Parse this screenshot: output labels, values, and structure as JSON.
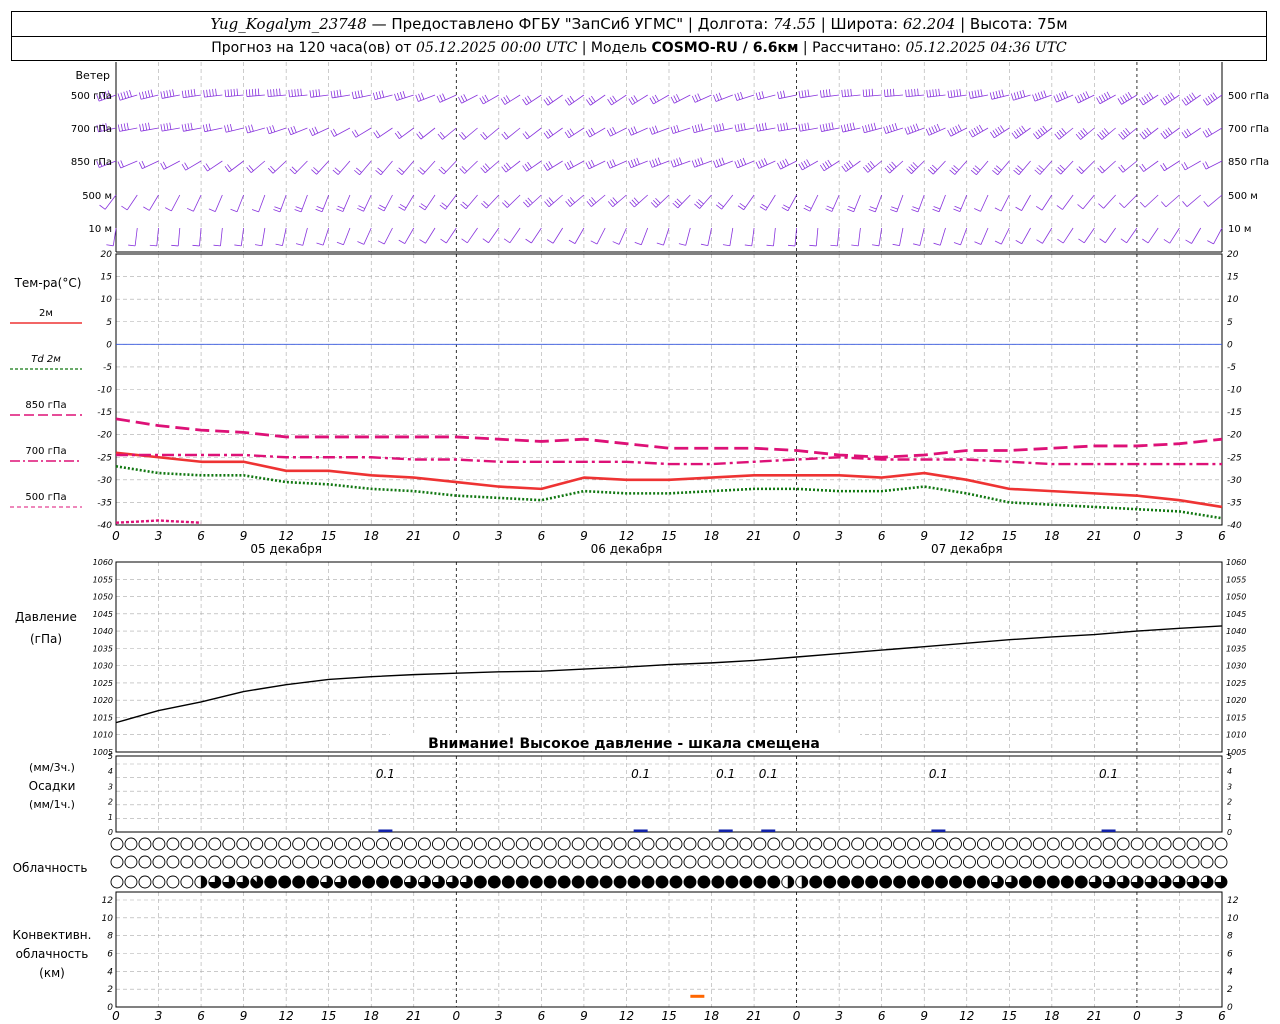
{
  "header": {
    "station": "Yug_Kogalym_23748",
    "provider": " — Предоставлено ФГБУ \"ЗапСиб УГМС\" | Долгота: ",
    "lon": "74.55",
    "lat_label": " | Широта: ",
    "lat": "62.204",
    "alt_label": " | Высота: ",
    "alt": "75м",
    "forecast_label": "Прогноз на 120 часа(ов) от ",
    "forecast_start": "05.12.2025 00:00 UTC",
    "model_label": "  | Модель ",
    "model": "COSMO-RU / 6.6км",
    "calc_label": " | Рассчитано: ",
    "calc_time": "05.12.2025 04:36 UTC"
  },
  "colors": {
    "t2m": "#ee3333",
    "td2m": "#117711",
    "t850": "#dd1177",
    "t700": "#dd1177",
    "t500": "#dd1177",
    "wind": "#8833dd",
    "zero_line": "#3355dd",
    "conv": "#ff6600",
    "precip": "#1122aa"
  },
  "wind_panel": {
    "title": "Ветер",
    "levels": [
      "500 гПа",
      "700 гПа",
      "850 гПа",
      "500 м",
      "10  м"
    ]
  },
  "temp_panel": {
    "title": "Тем-ра(°C)",
    "legend": [
      {
        "key": "t2m",
        "label": "2м"
      },
      {
        "key": "td2m",
        "label": "2м",
        "prefix": "Td"
      },
      {
        "key": "t850",
        "label": "850 гПа"
      },
      {
        "key": "t700",
        "label": "700 гПа"
      },
      {
        "key": "t500",
        "label": "500 гПа"
      }
    ],
    "ticks": [
      20,
      15,
      10,
      5,
      0,
      -5,
      -10,
      -15,
      -20,
      -25,
      -30,
      -35,
      -40
    ]
  },
  "x_axis": {
    "hour_labels": [
      "0",
      "3",
      "6",
      "9",
      "12",
      "15",
      "18",
      "21",
      "0",
      "3",
      "6",
      "9",
      "12",
      "15",
      "18",
      "21",
      "0",
      "3",
      "6",
      "9",
      "12",
      "15",
      "18",
      "21",
      "0",
      "3",
      "6"
    ],
    "day_labels": [
      "05 декабря",
      "06 декабря",
      "07 декабря"
    ]
  },
  "pressure_panel": {
    "title": "Давление",
    "unit": "(гПа)",
    "warning": "Внимание! Высокое давление - шкала смещена",
    "ticks": [
      1060,
      1055,
      1050,
      1045,
      1040,
      1035,
      1030,
      1025,
      1020,
      1015,
      1010,
      1005
    ]
  },
  "precip_panel": {
    "unit3h": "(мм/3ч.)",
    "title": "Осадки",
    "unit1h": "(мм/1ч.)",
    "ticks": [
      5,
      4,
      3,
      2,
      1,
      0
    ],
    "labels": [
      {
        "hour": 19,
        "value": "0.1"
      },
      {
        "hour": 37,
        "value": "0.1"
      },
      {
        "hour": 43,
        "value": "0.1"
      },
      {
        "hour": 46,
        "value": "0.1"
      },
      {
        "hour": 58,
        "value": "0.1"
      },
      {
        "hour": 70,
        "value": "0.1"
      }
    ]
  },
  "cloud_panel": {
    "title": "Облачность"
  },
  "conv_panel": {
    "title1": "Конвективн.",
    "title2": "облачность",
    "unit": "(км)",
    "ticks": [
      12,
      10,
      8,
      6,
      4,
      2,
      0
    ]
  },
  "chart_data": [
    {
      "type": "line",
      "title": "Тем-ра(°C)",
      "ylim": [
        -40,
        20
      ],
      "x_unit": "hours from 05.12.2025 00:00 UTC",
      "x": [
        0,
        3,
        6,
        9,
        12,
        15,
        18,
        21,
        24,
        27,
        30,
        33,
        36,
        39,
        42,
        45,
        48,
        51,
        54,
        57,
        60,
        63,
        66,
        69,
        72,
        75,
        78
      ],
      "series": [
        {
          "name": "2м",
          "key": "t2m",
          "values": [
            -24,
            -25,
            -26,
            -26,
            -28,
            -28,
            -29,
            -29.5,
            -30.5,
            -31.5,
            -32,
            -29.5,
            -30,
            -30,
            -29.5,
            -29,
            -29,
            -29,
            -29.5,
            -28.5,
            -30,
            -32,
            -32.5,
            -33,
            -33.5,
            -34.5,
            -36
          ]
        },
        {
          "name": "Td 2м",
          "key": "td2m",
          "values": [
            -27,
            -28.5,
            -29,
            -29,
            -30.5,
            -31,
            -32,
            -32.5,
            -33.5,
            -34,
            -34.5,
            -32.5,
            -33,
            -33,
            -32.5,
            -32,
            -32,
            -32.5,
            -32.5,
            -31.5,
            -33,
            -35,
            -35.5,
            -36,
            -36.5,
            -37,
            -38.5
          ]
        },
        {
          "name": "850 гПа",
          "key": "t850",
          "values": [
            -16.5,
            -18,
            -19,
            -19.5,
            -20.5,
            -20.5,
            -20.5,
            -20.5,
            -20.5,
            -21,
            -21.5,
            -21,
            -22,
            -23,
            -23,
            -23,
            -23.5,
            -24.5,
            -25,
            -24.5,
            -23.5,
            -23.5,
            -23,
            -22.5,
            -22.5,
            -22,
            -21
          ]
        },
        {
          "name": "700 гПа",
          "key": "t700",
          "values": [
            -24.5,
            -24.5,
            -24.5,
            -24.5,
            -25,
            -25,
            -25,
            -25.5,
            -25.5,
            -26,
            -26,
            -26,
            -26,
            -26.5,
            -26.5,
            -26,
            -25.5,
            -25,
            -25.5,
            -25.5,
            -25.5,
            -26,
            -26.5,
            -26.5,
            -26.5,
            -26.5,
            -26.5
          ]
        },
        {
          "name": "500 гПа",
          "key": "t500",
          "values": [
            -39.5,
            -39,
            -39.5
          ]
        }
      ]
    },
    {
      "type": "line",
      "title": "Давление",
      "ylim": [
        1005,
        1060
      ],
      "x_unit": "hours from 05.12.2025 00:00 UTC",
      "x": [
        0,
        3,
        6,
        9,
        12,
        15,
        18,
        21,
        24,
        27,
        30,
        33,
        36,
        39,
        42,
        45,
        48,
        51,
        54,
        57,
        60,
        63,
        66,
        69,
        72,
        75,
        78
      ],
      "series": [
        {
          "name": "Давление",
          "values": [
            1013.5,
            1017,
            1019.5,
            1022.5,
            1024.5,
            1026,
            1026.8,
            1027.4,
            1027.8,
            1028.2,
            1028.4,
            1029,
            1029.6,
            1030.3,
            1030.8,
            1031.5,
            1032.5,
            1033.5,
            1034.5,
            1035.5,
            1036.5,
            1037.5,
            1038.3,
            1039,
            1040,
            1040.8,
            1041.5
          ]
        }
      ]
    },
    {
      "type": "bar",
      "title": "Осадки",
      "ylim": [
        0,
        5
      ],
      "x_unit": "hours from 05.12.2025 00:00 UTC",
      "x": [
        19,
        37,
        43,
        46,
        58,
        70
      ],
      "series": [
        {
          "name": "Осадки",
          "values": [
            0.1,
            0.1,
            0.1,
            0.1,
            0.1,
            0.1
          ]
        }
      ]
    },
    {
      "type": "bar",
      "title": "Конвективн. облачность",
      "ylim": [
        0,
        12
      ],
      "x_unit": "hours from 05.12.2025 00:00 UTC",
      "x": [
        41
      ],
      "series": [
        {
          "name": "Конвективн. облачность",
          "values": [
            1.2
          ]
        }
      ]
    },
    {
      "type": "table",
      "title": "Облачность",
      "note": "cloud cover in eighths per 2-hour step; rows = upper, middle, lower",
      "rows": [
        [
          0,
          0,
          0,
          0,
          0,
          0,
          0,
          0,
          0,
          0,
          0,
          0,
          0,
          0,
          0,
          0,
          0,
          0,
          0,
          0,
          0,
          0,
          0,
          0,
          0,
          0,
          0,
          0,
          0,
          0,
          0,
          0,
          0,
          0,
          0,
          0,
          0,
          0,
          0,
          0,
          0,
          0,
          0,
          0,
          0,
          0,
          0,
          0,
          0,
          0,
          0,
          0,
          0,
          0,
          0,
          0,
          0,
          0,
          0,
          0,
          0,
          0,
          0,
          0,
          0,
          0,
          0,
          0,
          0,
          0,
          0,
          0,
          0,
          0,
          0,
          0,
          0,
          0,
          0,
          0
        ],
        [
          0,
          0,
          0,
          0,
          0,
          0,
          0,
          0,
          0,
          0,
          0,
          0,
          0,
          0,
          0,
          0,
          0,
          0,
          0,
          0,
          0,
          0,
          0,
          0,
          0,
          0,
          0,
          0,
          0,
          0,
          0,
          0,
          0,
          0,
          0,
          0,
          0,
          0,
          0,
          0,
          0,
          0,
          0,
          0,
          0,
          0,
          0,
          0,
          0,
          0,
          0,
          0,
          0,
          0,
          0,
          0,
          0,
          0,
          0,
          0,
          0,
          0,
          0,
          0,
          0,
          0,
          0,
          0,
          0,
          0,
          0,
          0,
          0,
          0,
          0,
          0,
          0,
          0,
          0,
          0
        ],
        [
          0,
          0,
          0,
          0,
          0,
          0,
          4,
          6,
          6,
          6,
          7,
          8,
          8,
          8,
          8,
          6,
          6,
          8,
          8,
          8,
          8,
          6,
          6,
          6,
          6,
          6,
          8,
          8,
          8,
          8,
          8,
          8,
          8,
          8,
          8,
          8,
          8,
          8,
          8,
          8,
          8,
          8,
          8,
          8,
          8,
          8,
          8,
          8,
          4,
          4,
          8,
          8,
          8,
          8,
          8,
          8,
          8,
          8,
          8,
          8,
          8,
          8,
          8,
          6,
          6,
          8,
          8,
          8,
          8,
          8,
          6,
          6,
          6,
          6,
          6,
          6,
          6,
          6,
          6,
          6
        ]
      ]
    },
    {
      "type": "table",
      "title": "Ветер",
      "note": "wind barbs (direction deg, speed m/s) at 500 гПа, 700 гПа, 850 гПа, 500 м, 10 м every 3 h",
      "levels": [
        "500 гПа",
        "700 гПа",
        "850 гПа",
        "500 м",
        "10  м"
      ],
      "direction": [
        250,
        245,
        235,
        215,
        200
      ],
      "speed": [
        25,
        22,
        18,
        12,
        4
      ]
    }
  ]
}
